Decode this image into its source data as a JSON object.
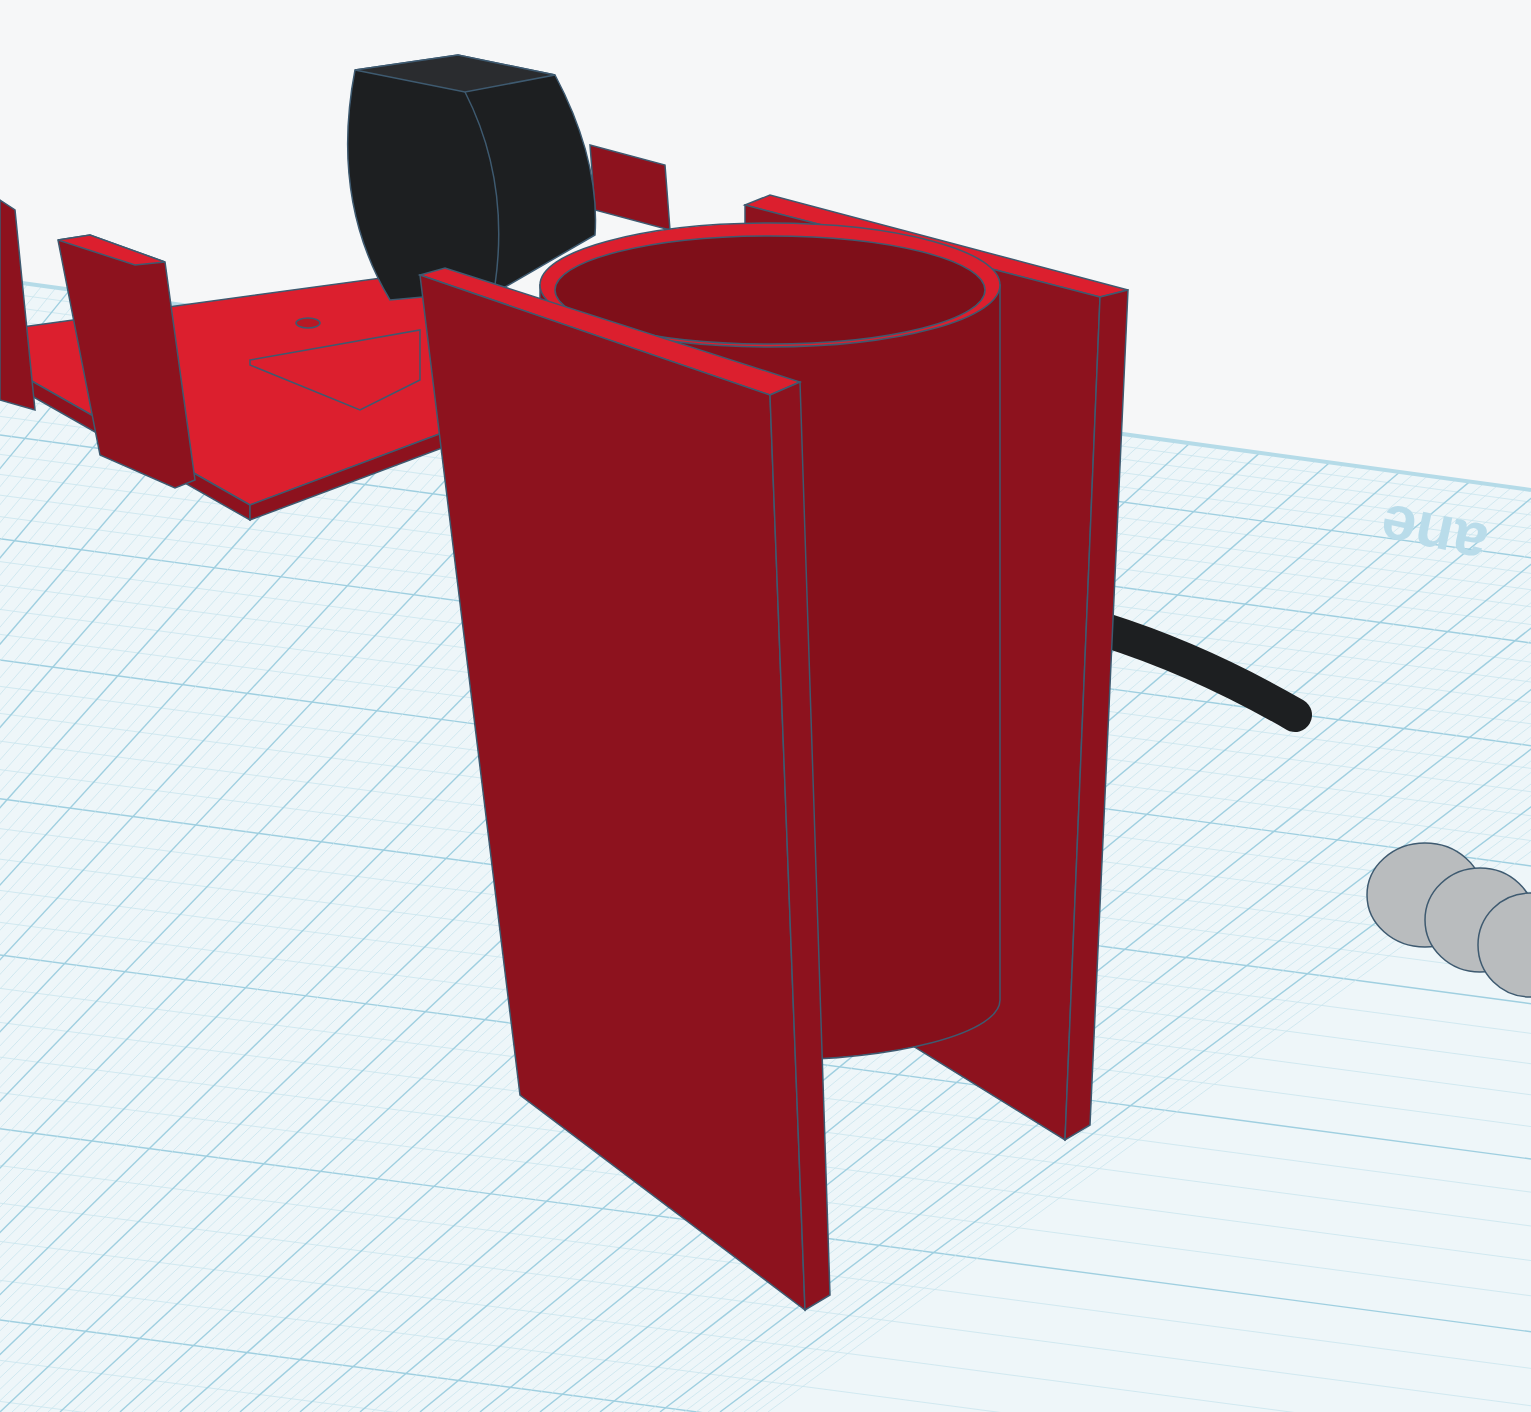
{
  "viewport": {
    "workplane_label": "ane"
  }
}
